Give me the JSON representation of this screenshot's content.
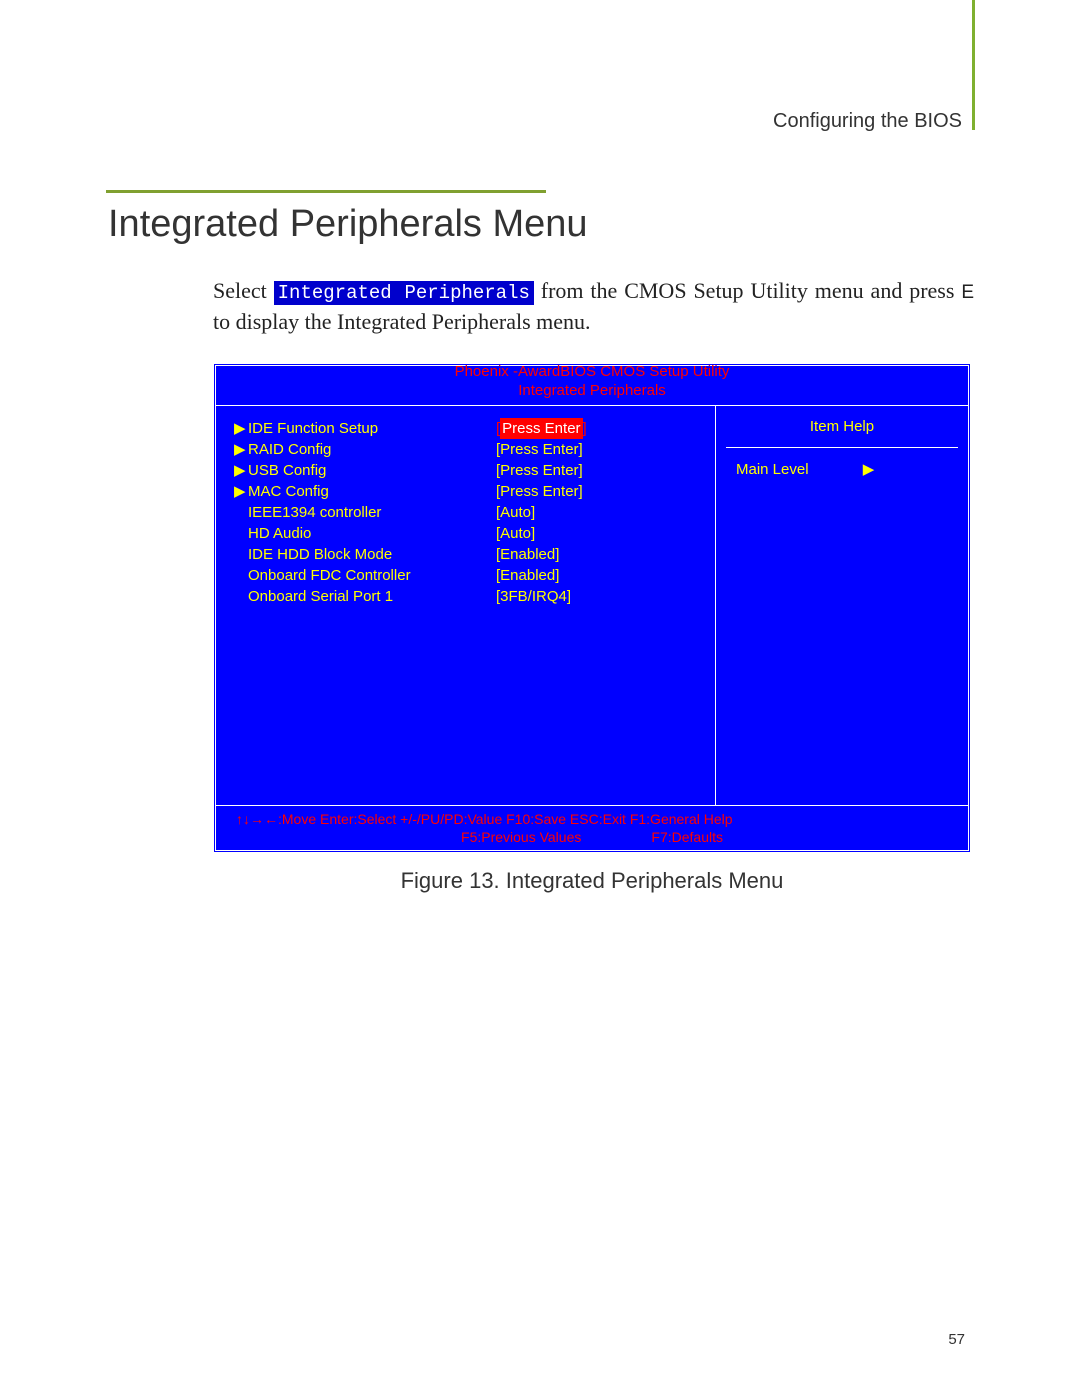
{
  "header": "Configuring the BIOS",
  "title": "Integrated Peripherals Menu",
  "body": {
    "pre": "Select ",
    "highlight": "Integrated Peripherals",
    "mid1": " from the CMOS Setup Utility menu and press ",
    "key": "E    ",
    "mid2": " to display the Integrated Peripherals menu."
  },
  "bios": {
    "header_line1": "Phoenix  -AwardBIOS CMOS Setup Utility",
    "header_line2": "Integrated Peripherals",
    "items": [
      {
        "arrow": "▶",
        "label": "IDE Function Setup",
        "value": "Press Enter",
        "selected": true
      },
      {
        "arrow": "▶",
        "label": "RAID Config",
        "value": "Press Enter]"
      },
      {
        "arrow": "▶",
        "label": "USB Config",
        "value": "Press Enter]"
      },
      {
        "arrow": "▶",
        "label": "MAC Config",
        "value": "Press Enter]"
      },
      {
        "arrow": "",
        "label": "IEEE1394 controller",
        "value": "Auto]"
      },
      {
        "arrow": "",
        "label": "HD Audio",
        "value": "Auto]"
      },
      {
        "arrow": "",
        "label": "IDE HDD Block Mode",
        "value": "Enabled]"
      },
      {
        "arrow": "",
        "label": "Onboard FDC Controller",
        "value": "Enabled]"
      },
      {
        "arrow": "",
        "label": "Onboard Serial Port 1",
        "value": "3FB/IRQ4]"
      }
    ],
    "help_title": "Item Help",
    "help_body": "Main Level",
    "help_arrow": "▶",
    "footer1": "↑↓→←:Move  Enter:Select  +/-/PU/PD:Value  F10:Save  ESC:Exit  F1:General Help",
    "footer2a": "F5:Previous  Values",
    "footer2b": "F7:Defaults"
  },
  "caption": "Figure 13.    Integrated Peripherals Menu",
  "page_num": "57"
}
